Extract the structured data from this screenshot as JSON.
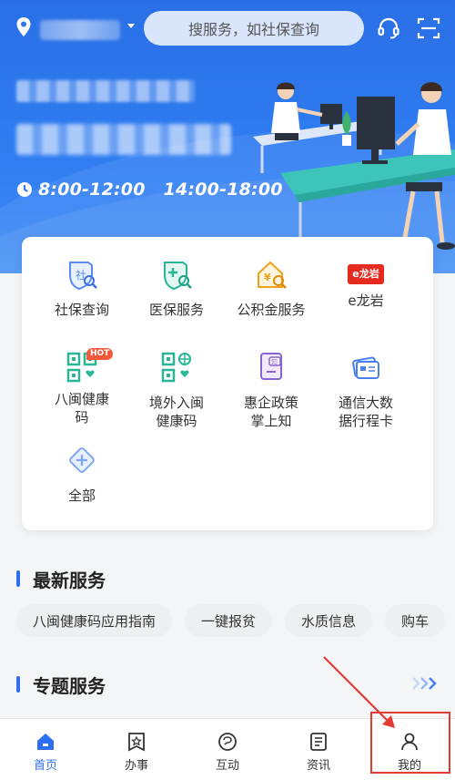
{
  "search": {
    "placeholder": "搜服务，如社保查询"
  },
  "hero": {
    "hours_morning": "8:00-12:00",
    "hours_afternoon": "14:00-18:00"
  },
  "services": [
    {
      "label": "社保查询",
      "icon": "social-security-icon"
    },
    {
      "label": "医保服务",
      "icon": "medical-insurance-icon"
    },
    {
      "label": "公积金服务",
      "icon": "housing-fund-icon"
    },
    {
      "label": "e龙岩",
      "icon": "e-longyan-logo",
      "logo_text": "e龙岩"
    },
    {
      "label": "八闽健康码",
      "icon": "health-code-icon",
      "badge": "HOT"
    },
    {
      "label": "境外入闽健康码",
      "icon": "overseas-health-code-icon"
    },
    {
      "label": "惠企政策掌上知",
      "icon": "policy-icon"
    },
    {
      "label": "通信大数据行程卡",
      "icon": "itinerary-card-icon"
    },
    {
      "label": "全部",
      "icon": "all-services-icon"
    }
  ],
  "latest": {
    "title": "最新服务",
    "chips": [
      "八闽健康码应用指南",
      "一键报贫",
      "水质信息",
      "购车"
    ]
  },
  "special": {
    "title": "专题服务"
  },
  "nav": [
    {
      "label": "首页",
      "icon": "home-icon",
      "active": true
    },
    {
      "label": "办事",
      "icon": "services-icon"
    },
    {
      "label": "互动",
      "icon": "interact-icon"
    },
    {
      "label": "资讯",
      "icon": "news-icon"
    },
    {
      "label": "我的",
      "icon": "profile-icon"
    }
  ],
  "colors": {
    "primary": "#2d6ff0",
    "hot": "#f25a3b",
    "highlight": "#e53935"
  }
}
